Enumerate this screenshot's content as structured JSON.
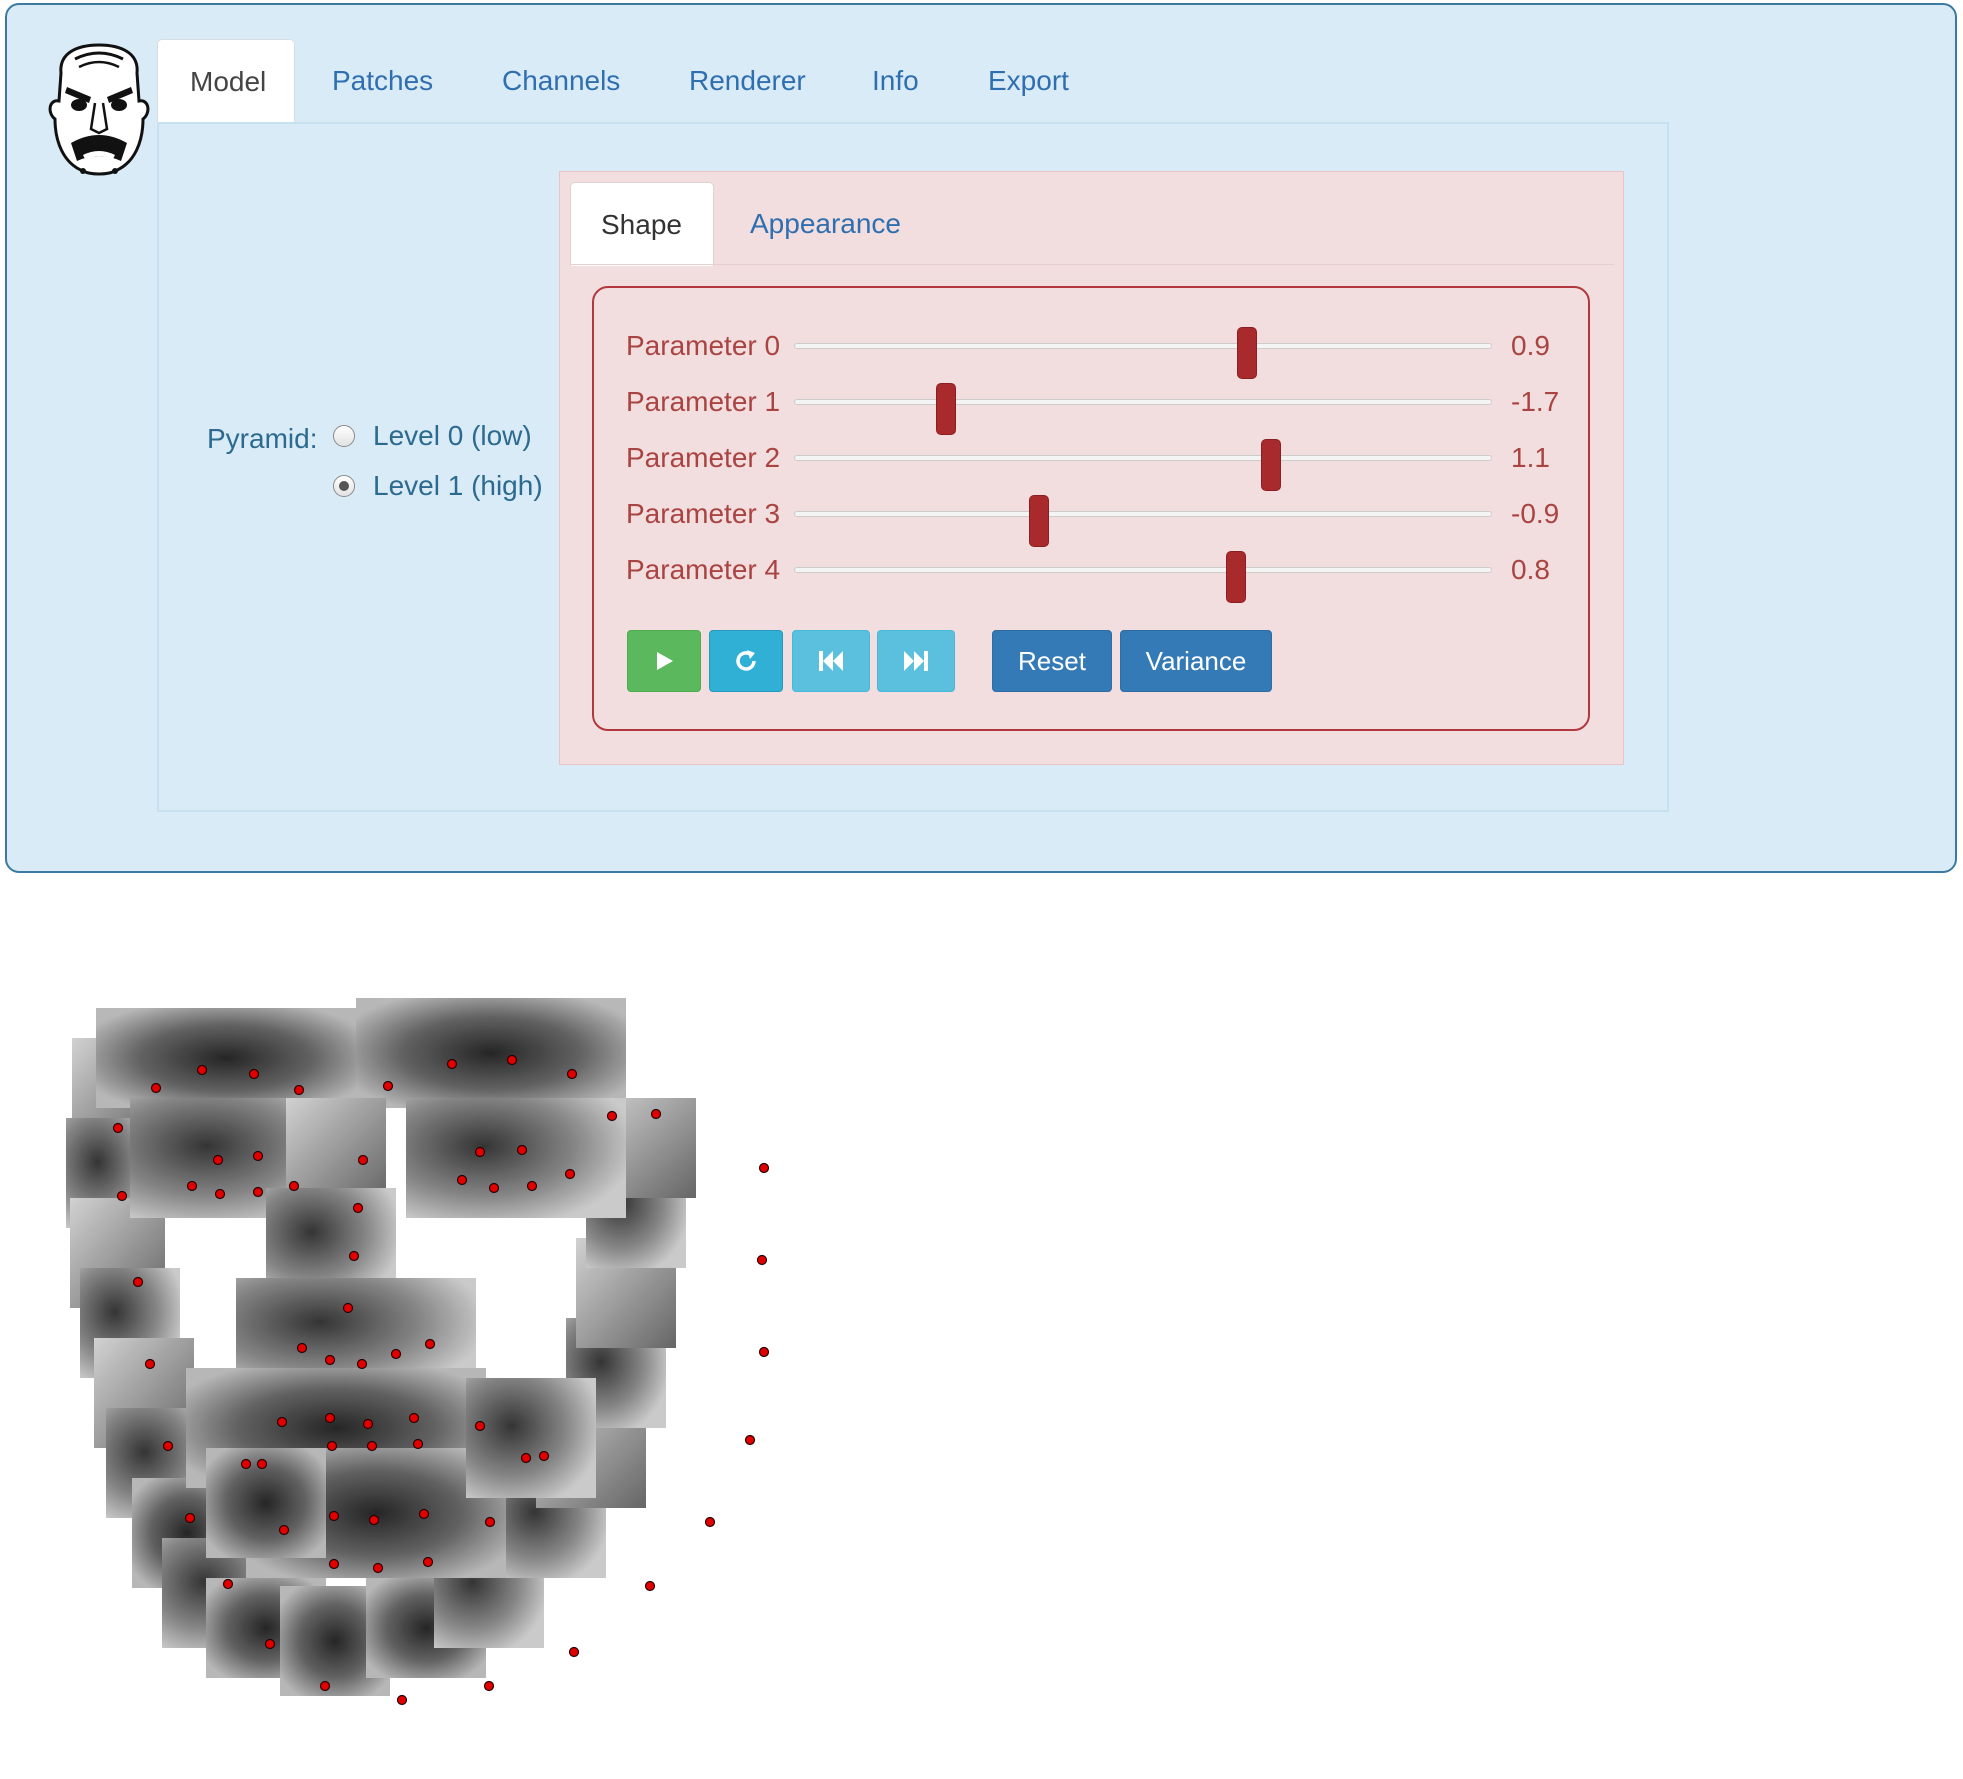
{
  "logo": {
    "icon": "angry-mask-icon"
  },
  "tabs": [
    {
      "label": "Model",
      "active": true
    },
    {
      "label": "Patches",
      "active": false
    },
    {
      "label": "Channels",
      "active": false
    },
    {
      "label": "Renderer",
      "active": false
    },
    {
      "label": "Info",
      "active": false
    },
    {
      "label": "Export",
      "active": false
    }
  ],
  "pyramid": {
    "label": "Pyramid:",
    "options": [
      {
        "label": "Level 0 (low)",
        "checked": false
      },
      {
        "label": "Level 1 (high)",
        "checked": true
      }
    ]
  },
  "subtabs": [
    {
      "label": "Shape",
      "active": true
    },
    {
      "label": "Appearance",
      "active": false
    }
  ],
  "parameters": {
    "range": [
      -3,
      3
    ],
    "items": [
      {
        "label": "Parameter 0",
        "value": "0.9"
      },
      {
        "label": "Parameter 1",
        "value": "-1.7"
      },
      {
        "label": "Parameter 2",
        "value": "1.1"
      },
      {
        "label": "Parameter 3",
        "value": "-0.9"
      },
      {
        "label": "Parameter 4",
        "value": "0.8"
      }
    ]
  },
  "controls": {
    "play_icon": "play-icon",
    "loop_icon": "refresh-icon",
    "prev_icon": "skip-back-icon",
    "next_icon": "skip-forward-icon",
    "reset_label": "Reset",
    "variance_label": "Variance"
  },
  "colors": {
    "panel_bg": "#d9ebf6",
    "danger_text": "#a94442",
    "slider_thumb": "#a82a2c",
    "landmark_point": "#e00000",
    "primary_button": "#337ab7",
    "success_button": "#5cb85c",
    "info_button": "#5bc0de"
  },
  "visualization": {
    "name": "face-patch-model-render",
    "landmark_color": "#e00000"
  }
}
